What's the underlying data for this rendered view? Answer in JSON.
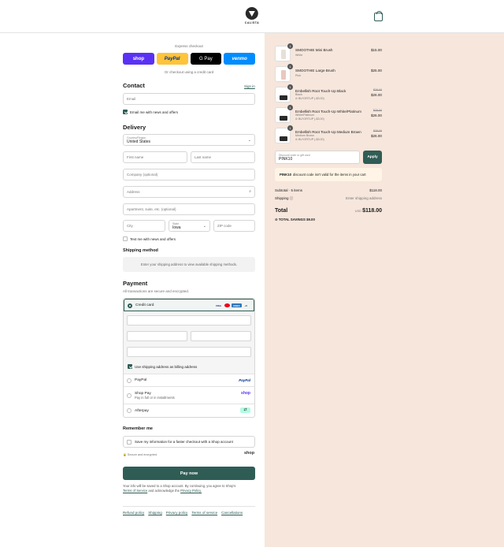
{
  "brand": {
    "name": "CALISTA"
  },
  "express": {
    "title": "Express checkout",
    "buttons": [
      "shop",
      "PayPal",
      "G Pay",
      "venmo"
    ],
    "or_text": "Or checkout using a credit card"
  },
  "contact": {
    "title": "Contact",
    "signin": "Sign in",
    "email_placeholder": "Email",
    "news_label": "Email me with news and offers"
  },
  "delivery": {
    "title": "Delivery",
    "country_label": "Country/Region",
    "country_value": "United States",
    "first_name": "First name",
    "last_name": "Last name",
    "company": "Company (optional)",
    "address": "Address",
    "apartment": "Apartment, suite, etc. (optional)",
    "city": "City",
    "state_label": "State",
    "state_value": "Iowa",
    "zip": "ZIP code",
    "text_label": "Text me with news and offers"
  },
  "shipping": {
    "title": "Shipping method",
    "message": "Enter your shipping address to view available shipping methods."
  },
  "payment": {
    "title": "Payment",
    "subtitle": "All transactions are secure and encrypted.",
    "credit_card": "Credit card",
    "card_logos": [
      "VISA",
      "MC",
      "AMEX",
      "+5"
    ],
    "billing_label": "Use shipping address as billing address",
    "paypal": "PayPal",
    "paypal_logo": "PayPal",
    "shoppay": "Shop Pay",
    "shoppay_sub": "Pay in full or in installments",
    "shoppay_logo": "shop",
    "afterpay": "Afterpay"
  },
  "remember": {
    "title": "Remember me",
    "label": "Save my information for a faster checkout with a Shop account",
    "secure": "Secure and encrypted",
    "shop_logo": "shop"
  },
  "paynow": "Pay now",
  "legal": {
    "text": "Your info will be saved to a Shop account. By continuing, you agree to Shop's",
    "terms": "Terms of Service",
    "and": "and acknowledge the",
    "privacy": "Privacy Policy."
  },
  "footer": [
    "Refund policy",
    "Shipping",
    "Privacy policy",
    "Terms of service",
    "Cancellations"
  ],
  "cart": {
    "items": [
      {
        "qty": "1",
        "name": "SMOOTHIE Mini Brush",
        "variant": "White",
        "price": "$15.00",
        "color": "#e8e0d8"
      },
      {
        "qty": "1",
        "name": "SMOOTHIE Large Brush",
        "variant": "Pink",
        "price": "$25.00",
        "color": "#e8c8c0"
      },
      {
        "qty": "1",
        "name": "Embellish Root Touch-Up Black",
        "variant": "Black",
        "discount": "BUY2RTUP (-$3.00)",
        "orig": "$29.00",
        "price": "$26.00",
        "color": "#2a2a2a"
      },
      {
        "qty": "1",
        "name": "Embellish Root Touch-Up White/Platinum",
        "variant": "White/Platinum",
        "discount": "BUY2RTUP (-$3.00)",
        "orig": "$29.00",
        "price": "$26.00",
        "color": "#2a2a2a"
      },
      {
        "qty": "1",
        "name": "Embellish Root Touch-Up Medium Brown",
        "variant": "Medium Brown",
        "discount": "BUY2RTUP (-$3.00)",
        "orig": "$29.00",
        "price": "$26.00",
        "color": "#2a2a2a"
      }
    ],
    "discount_label": "Discount code or gift card",
    "discount_value": "PINK10",
    "apply": "Apply",
    "error_code": "PINK10",
    "error_text": "discount code isn't valid for the items in your cart",
    "subtotal_label": "Subtotal · 5 items",
    "subtotal": "$118.00",
    "shipping_label": "Shipping",
    "shipping_value": "Enter shipping address",
    "total_label": "Total",
    "currency": "USD",
    "total": "$118.00",
    "savings_label": "TOTAL SAVINGS",
    "savings": "$9.00",
    "accent": "#2f5d55",
    "bg": "#f6e6dc"
  }
}
